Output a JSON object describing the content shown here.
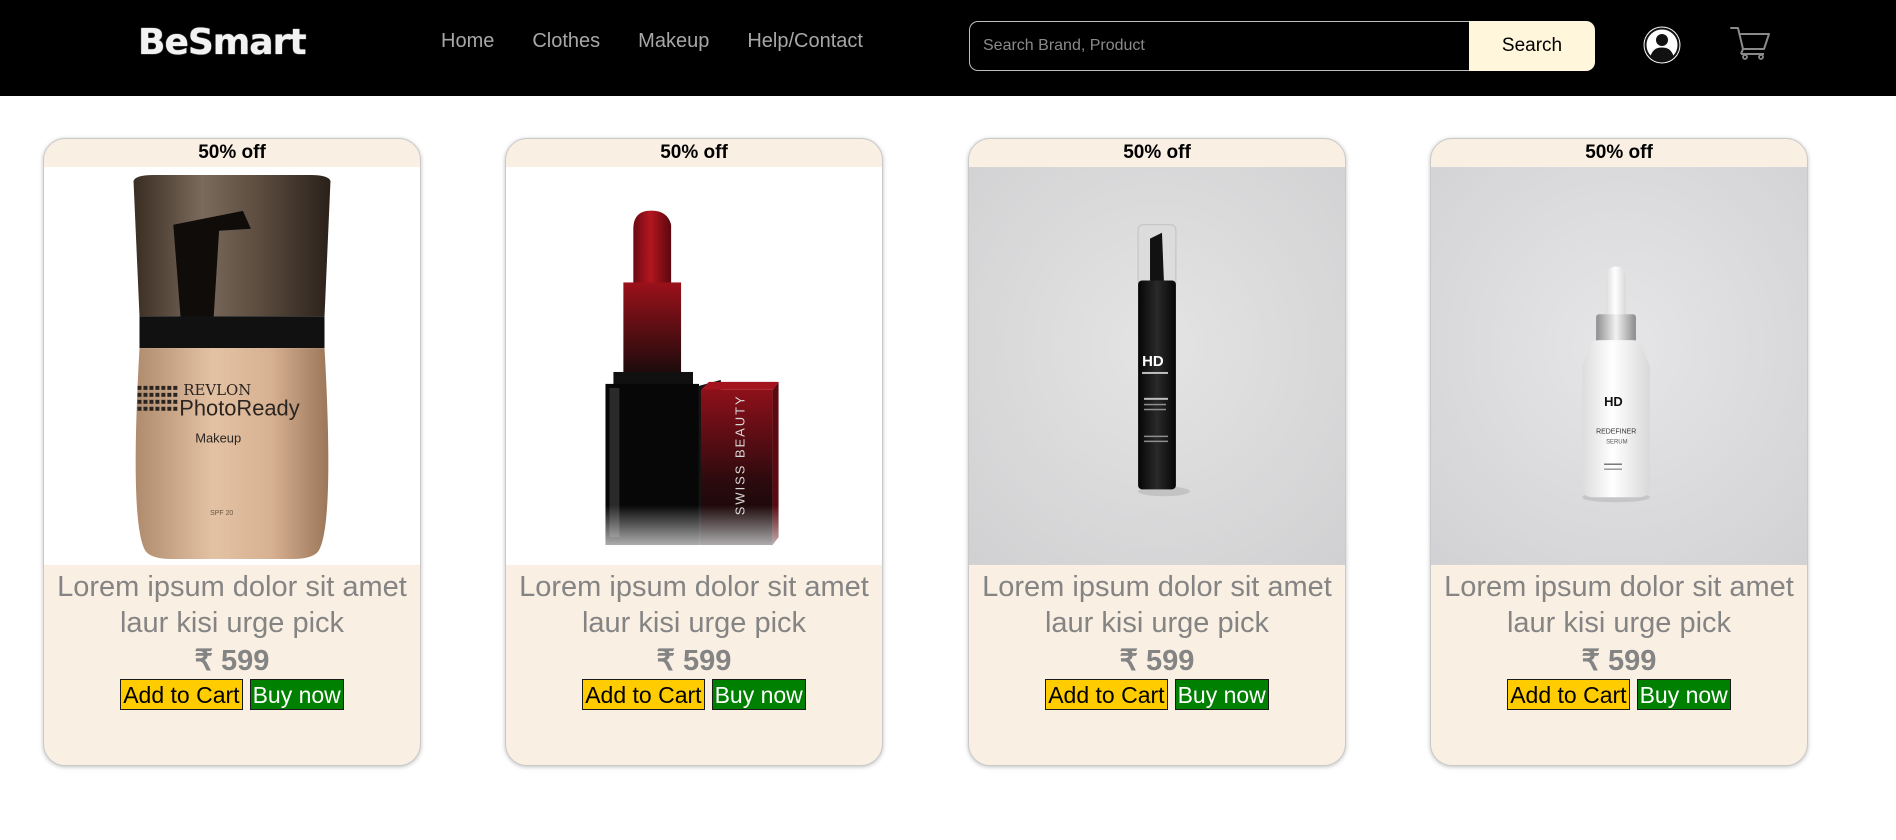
{
  "header": {
    "logo": "BeSmart",
    "nav": [
      "Home",
      "Clothes",
      "Makeup",
      "Help/Contact"
    ],
    "search_placeholder": "Search Brand, Product",
    "search_value": "",
    "search_label": "Search",
    "user_icon": "user-circle-icon",
    "cart_icon": "shopping-cart-icon"
  },
  "colors": {
    "header_bg": "#000000",
    "card_bg": "#faefe3",
    "add_to_cart": "#ffcc00",
    "buy_now": "#008000",
    "search_button": "#fff6dc"
  },
  "products": [
    {
      "discount": "50% off",
      "title": "Lorem ipsum dolor sit amet laur kisi urge pick",
      "price": "₹ 599",
      "add_to_cart": "Add to Cart",
      "buy_now": "Buy now",
      "label_lines": [
        "REVLON",
        "PhotoReady",
        "Makeup",
        "SPF 20"
      ]
    },
    {
      "discount": "50% off",
      "title": "Lorem ipsum dolor sit amet laur kisi urge pick",
      "price": "₹ 599",
      "add_to_cart": "Add to Cart",
      "buy_now": "Buy now",
      "label_lines": [
        "SWISS BEAUTY"
      ]
    },
    {
      "discount": "50% off",
      "title": "Lorem ipsum dolor sit amet laur kisi urge pick",
      "price": "₹ 599",
      "add_to_cart": "Add to Cart",
      "buy_now": "Buy now",
      "label_lines": [
        "HD"
      ]
    },
    {
      "discount": "50% off",
      "title": "Lorem ipsum dolor sit amet laur kisi urge pick",
      "price": "₹ 599",
      "add_to_cart": "Add to Cart",
      "buy_now": "Buy now",
      "label_lines": [
        "HD",
        "REDEFINER",
        "SERUM"
      ]
    }
  ]
}
